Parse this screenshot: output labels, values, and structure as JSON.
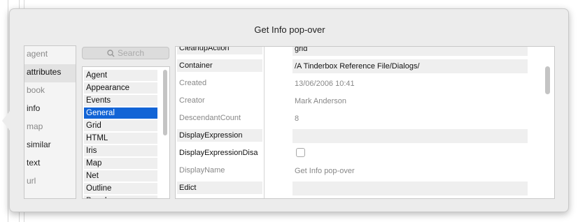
{
  "popover": {
    "title": "Get Info pop-over"
  },
  "tabs": [
    {
      "label": "agent",
      "state": "dim"
    },
    {
      "label": "attributes",
      "state": "selected"
    },
    {
      "label": "book",
      "state": "dim"
    },
    {
      "label": "info",
      "state": "active"
    },
    {
      "label": "map",
      "state": "dim"
    },
    {
      "label": "similar",
      "state": "active"
    },
    {
      "label": "text",
      "state": "active"
    },
    {
      "label": "url",
      "state": "dim"
    }
  ],
  "search": {
    "placeholder": "Search",
    "icon": "search-icon"
  },
  "categories": [
    {
      "label": "Agent",
      "selected": false
    },
    {
      "label": "Appearance",
      "selected": false
    },
    {
      "label": "Events",
      "selected": false
    },
    {
      "label": "General",
      "selected": true
    },
    {
      "label": "Grid",
      "selected": false
    },
    {
      "label": "HTML",
      "selected": false
    },
    {
      "label": "Iris",
      "selected": false
    },
    {
      "label": "Map",
      "selected": false
    },
    {
      "label": "Net",
      "selected": false
    },
    {
      "label": "Outline",
      "selected": false
    },
    {
      "label": "People",
      "selected": false
    }
  ],
  "attributes": [
    {
      "name": "CleanupAction",
      "value": "grid",
      "name_style": "editable",
      "value_style": "field"
    },
    {
      "name": "Container",
      "value": "/A Tinderbox Reference File/Dialogs/",
      "name_style": "editable",
      "value_style": "field"
    },
    {
      "name": "Created",
      "value": "13/06/2006 10:41",
      "name_style": "readonly",
      "value_style": "readonly"
    },
    {
      "name": "Creator",
      "value": "Mark Anderson",
      "name_style": "readonly",
      "value_style": "readonly"
    },
    {
      "name": "DescendantCount",
      "value": "8",
      "name_style": "readonly",
      "value_style": "readonly"
    },
    {
      "name": "DisplayExpression",
      "value": "",
      "name_style": "editable",
      "value_style": "field"
    },
    {
      "name": "DisplayExpressionDisa",
      "value": "",
      "name_style": "plain",
      "value_style": "checkbox"
    },
    {
      "name": "DisplayName",
      "value": "Get Info pop-over",
      "name_style": "readonly",
      "value_style": "readonly"
    },
    {
      "name": "Edict",
      "value": "",
      "name_style": "editable",
      "value_style": "field"
    },
    {
      "name": "",
      "value": "",
      "name_style": "plain",
      "value_style": "checkbox"
    }
  ],
  "colors": {
    "selection": "#1264d6",
    "panel_bg": "#ececec"
  }
}
